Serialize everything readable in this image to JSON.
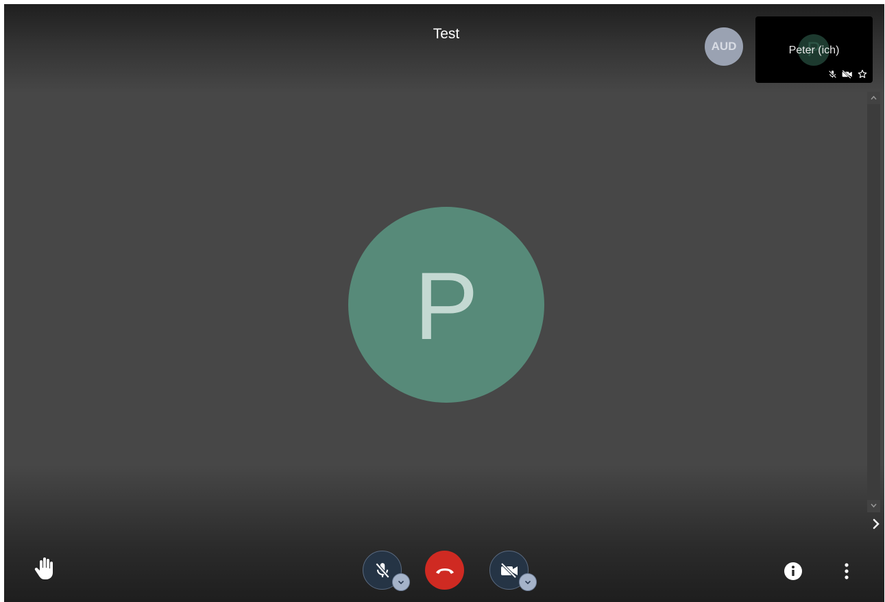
{
  "meeting": {
    "title": "Test"
  },
  "participants": {
    "audio_badge": "AUD",
    "self_tile": {
      "name": "Peter (ich)",
      "avatar_initial": "P"
    }
  },
  "main_view": {
    "avatar_initial": "P",
    "avatar_color": "#578a79"
  },
  "toolbar": {
    "icons": [
      "raise-hand-icon",
      "mic-off-icon",
      "hangup-icon",
      "camera-off-icon",
      "info-icon",
      "more-vertical-icon"
    ],
    "hangup_color": "#cf2a22"
  }
}
